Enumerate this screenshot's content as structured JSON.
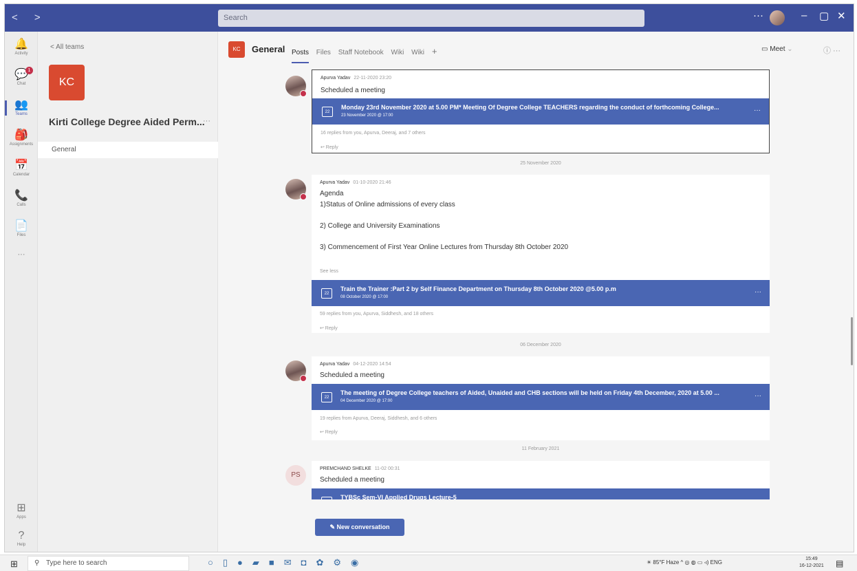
{
  "titlebar": {
    "nav": "< >",
    "search_placeholder": "Search",
    "more": "···",
    "minimize": "–",
    "maximize": "▢",
    "close": "✕"
  },
  "rail": [
    {
      "label": "Activity",
      "icon": "bell-icon",
      "glyph": "🔔"
    },
    {
      "label": "Chat",
      "icon": "chat-icon",
      "glyph": "💬",
      "badge": "1"
    },
    {
      "label": "Teams",
      "icon": "teams-icon",
      "glyph": "👥"
    },
    {
      "label": "Assignments",
      "icon": "assignments-icon",
      "glyph": "🎒"
    },
    {
      "label": "Calendar",
      "icon": "calendar-icon",
      "glyph": "📅"
    },
    {
      "label": "Calls",
      "icon": "phone-icon",
      "glyph": "📞"
    },
    {
      "label": "Files",
      "icon": "file-icon",
      "glyph": "📄"
    },
    {
      "label": "···",
      "icon": "more-icon",
      "glyph": ""
    },
    {
      "label": "Apps",
      "icon": "apps-icon",
      "glyph": "⊞"
    },
    {
      "label": "Help",
      "icon": "help-icon",
      "glyph": "?"
    }
  ],
  "team": {
    "back": "< All teams",
    "avatar": "KC",
    "name": "Kirti College Degree Aided Perm...",
    "more": "···",
    "channel": "General"
  },
  "channel": {
    "avatar": "KC",
    "title": "General",
    "tabs": [
      "Posts",
      "Files",
      "Staff Notebook",
      "Wiki",
      "Wiki",
      "+"
    ],
    "meet": "Meet",
    "icons": "ⓘ ···"
  },
  "posts": [
    {
      "author": "Apurva Yadav",
      "time": "22-11-2020 23:20",
      "text": "Scheduled a meeting",
      "card_title": "Monday 23rd November 2020 at 5.00 PM* Meeting Of Degree College TEACHERS regarding the conduct of forthcoming College...",
      "card_sub": "23 November 2020 @ 17:00",
      "replies": "16 replies from you, Apurva, Deeraj, and 7 others",
      "reply": "↩ Reply"
    },
    {
      "author": "Apurva Yadav",
      "time": "01-10-2020 21:46",
      "lines": [
        "Agenda",
        "1)Status of Online admissions of every class",
        "2) College and University Examinations",
        "3) Commencement of First Year Online Lectures from Thursday 8th October 2020"
      ],
      "see_less": "See less",
      "card_title": "Train the Trainer :Part 2 by Self Finance Department on Thursday 8th October 2020 @5.00 p.m",
      "card_sub": "08 October 2020 @ 17:00",
      "replies": "59 replies from you, Apurva, Siddhesh, and 18 others",
      "reply": "↩ Reply"
    },
    {
      "author": "Apurva Yadav",
      "time": "04-12-2020 14:54",
      "text": "Scheduled a meeting",
      "card_title": "The meeting of Degree College teachers of Aided, Unaided and CHB sections will be held on Friday 4th December, 2020 at 5.00 ...",
      "card_sub": "04 December 2020 @ 17:00",
      "replies": "19 replies from Apurva, Deeraj, Siddhesh, and 6 others",
      "reply": "↩ Reply"
    },
    {
      "author": "PREMCHAND SHELKE",
      "initials": "PS",
      "time": "11-02 00:31",
      "text": "Scheduled a meeting",
      "card_title": "TYBSc Sem-VI Applied Drugs Lecture-5"
    }
  ],
  "date_separators": [
    "25 November 2020",
    "06 December 2020",
    "11 February 2021"
  ],
  "new_conversation": "New conversation",
  "taskbar": {
    "search": "Type here to search",
    "weather": "85°F Haze",
    "lang": "ENG",
    "time": "15:49",
    "date": "16-12-2021"
  }
}
